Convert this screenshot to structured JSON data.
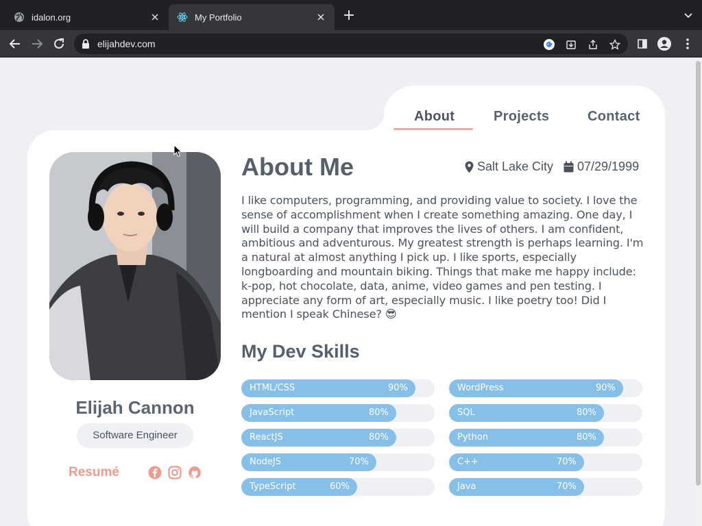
{
  "browser": {
    "tabs": [
      {
        "title": "idalon.org",
        "icon": "globe-icon"
      },
      {
        "title": "My Portfolio",
        "icon": "react-icon"
      }
    ],
    "url": "elijahdev.com"
  },
  "nav": {
    "about": "About",
    "projects": "Projects",
    "contact": "Contact"
  },
  "profile": {
    "name": "Elijah Cannon",
    "role": "Software Engineer",
    "resume": "Resumé"
  },
  "about": {
    "heading": "About Me",
    "location": "Salt Lake City",
    "birthdate": "07/29/1999",
    "bio": "I like computers, programming, and providing value to society. I love the sense of accomplishment when I create something amazing. One day, I will build a company that improves the lives of others. I am confident, ambitious and adventurous. My greatest strength is perhaps learning. I'm a natural at almost anything I pick up. I like sports, especially longboarding and mountain biking. Things that make me happy include: k-pop, hot chocolate, data, anime, video games and pen testing. I appreciate any form of art, especially music. I like poetry too! Did I mention I speak Chinese? 😎"
  },
  "skills": {
    "heading": "My Dev Skills",
    "left": [
      {
        "name": "HTML/CSS",
        "percent": 90,
        "label": "90%"
      },
      {
        "name": "JavaScript",
        "percent": 80,
        "label": "80%"
      },
      {
        "name": "ReactJS",
        "percent": 80,
        "label": "80%"
      },
      {
        "name": "NodeJS",
        "percent": 70,
        "label": "70%"
      },
      {
        "name": "TypeScript",
        "percent": 60,
        "label": "60%"
      }
    ],
    "right": [
      {
        "name": "WordPress",
        "percent": 90,
        "label": "90%"
      },
      {
        "name": "SQL",
        "percent": 80,
        "label": "80%"
      },
      {
        "name": "Python",
        "percent": 80,
        "label": "80%"
      },
      {
        "name": "C++",
        "percent": 70,
        "label": "70%"
      },
      {
        "name": "Java",
        "percent": 70,
        "label": "70%"
      }
    ]
  },
  "colors": {
    "accent": "#86c0e8",
    "resume": "#ee9a8f",
    "underline": "#f0a6a0"
  }
}
